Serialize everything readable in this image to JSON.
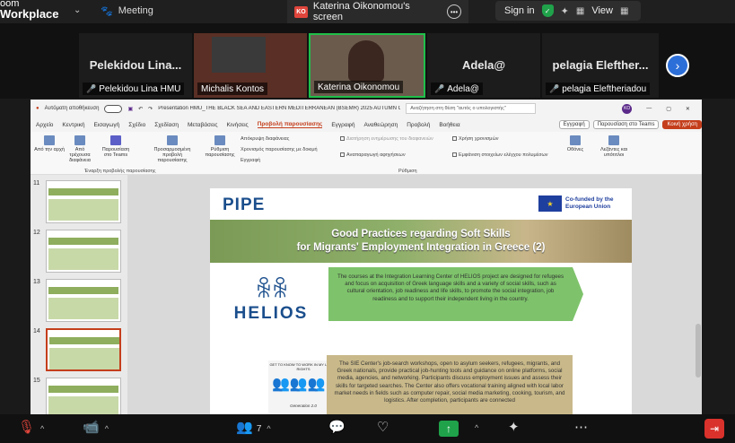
{
  "topbar": {
    "brand_line1": "oom",
    "brand_line2": "Workplace",
    "meeting_tab": "Meeting",
    "share_tab": "Katerina Oikonomou's screen",
    "ko_badge": "KO",
    "signin": "Sign in",
    "view": "View"
  },
  "gallery": {
    "tiles": [
      {
        "name": "Pelekidou  Lina...",
        "label": "Pelekidou Lina HMU"
      },
      {
        "name": "",
        "label": "Michalis Kontos"
      },
      {
        "name": "",
        "label": "Katerina Oikonomou"
      },
      {
        "name": "Adela@",
        "label": "Adela@"
      },
      {
        "name": "pelagia  Elefther...",
        "label": "pelagia Eleftheriadou"
      }
    ]
  },
  "ppt": {
    "title": "Presentation HMU_THE BLACK SEA AND EASTERN MEDITERRANEAN (BSEMR) 2025 AUTUMN CON...",
    "autosave": "Αυτόματη αποθήκευση",
    "search": "Αναζήτηση στη θέση \"αυτός ο υπολογιστής\"",
    "menu": [
      "Αρχείο",
      "Κεντρική",
      "Εισαγωγή",
      "Σχέδιο",
      "Σχεδίαση",
      "Μεταβάσεις",
      "Κινήσεις",
      "Προβολή παρουσίασης",
      "Εγγραφή",
      "Αναθεώρηση",
      "Προβολή",
      "Βοήθεια"
    ],
    "menu_active_index": 7,
    "buttons": {
      "record": "Εγγραφή",
      "teams": "Παρουσίαση στο Teams",
      "share": "Κοινή χρήση"
    },
    "ribbon": {
      "from_start": "Από την αρχή",
      "from_current": "Από τρέχουσα διαφάνεια",
      "present_teams": "Παρουσίαση στο Teams",
      "custom": "Προσαρμοσμένη προβολή παρουσίασης",
      "group1": "Έναρξη προβολής παρουσίασης",
      "setup": "Ρύθμιση παρουσίασης",
      "hide": "Απόκρυψη διαφάνειας",
      "rehearse": "Χρονισμός παρουσίασης με δοκιμή",
      "record": "Εγγραφή",
      "use_timings": "Χρήση χρονισμών",
      "narration": "Αναπαραγωγή αφηγήσεων",
      "show_controls": "Εμφάνιση στοιχείων ελέγχου πολυμέσων",
      "keep_updated": "Διατήρηση ενημέρωσης του διαφανειών",
      "group2": "Ρύθμιση",
      "monitor": "Οθόνες",
      "subtitles": "Λεζάντες και υπότιτλοι"
    },
    "thumbnails": [
      "11",
      "12",
      "13",
      "14",
      "15"
    ],
    "selected_thumb": "14"
  },
  "slide": {
    "logo": "PIPE",
    "eu_text": "Co-funded by the European Union",
    "title_line1": "Good Practices regarding Soft Skills",
    "title_line2": "for Migrants' Employment Integration in Greece (2)",
    "helios_word": "HELIOS",
    "box1": "The courses at the Integration Learning Center of HELIOS project are designed for refugees and focus on acquisition of Greek language skills and a variety of social skills, such as cultural orientation, job readiness and life skills, to promote the social integration, job readiness and to support their independent living in the country.",
    "sie_top": "GET TO KNOW TO WORK IN MY LABOR RIGHTS",
    "sie_caption": "Generation 2.0",
    "box2": "The SIE Center's job-search workshops, open to asylum seekers, refugees, migrants, and Greek nationals, provide practical job-hunting tools and guidance on online platforms, social media, agencies, and networking. Participants discuss employment issues and assess their skills for targeted searches. The Center also offers vocational training aligned with local labor market needs in fields such as computer repair, social media marketing, cooking, tourism, and logistics. After completion, participants are connected"
  },
  "bottombar": {
    "participants_count": "7"
  },
  "colors": {
    "accent_green": "#1fa24a",
    "leave_red": "#d9312b",
    "ppt_accent": "#c43e1c"
  }
}
